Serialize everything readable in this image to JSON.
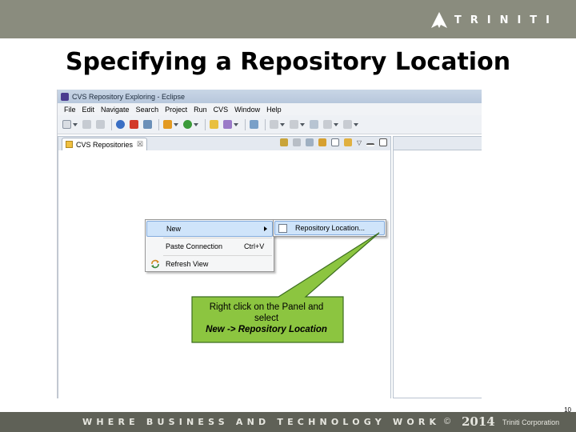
{
  "brand": {
    "name": "TRINITI",
    "logo_icon": "triniti-arrow-logo"
  },
  "slide": {
    "title": "Specifying a Repository Location",
    "page_number": "10"
  },
  "window": {
    "title": "CVS Repository Exploring - Eclipse",
    "menu": [
      "File",
      "Edit",
      "Navigate",
      "Search",
      "Project",
      "Run",
      "CVS",
      "Window",
      "Help"
    ],
    "view_tab": {
      "label": "CVS Repositories",
      "close_symbol": "☒"
    }
  },
  "context_menu": {
    "items": [
      {
        "label": "New",
        "shortcut": "",
        "has_submenu": true,
        "selected": true
      },
      {
        "label": "Paste Connection",
        "shortcut": "Ctrl+V",
        "has_submenu": false,
        "selected": false
      },
      {
        "label": "Refresh View",
        "shortcut": "",
        "has_submenu": false,
        "selected": false
      }
    ],
    "submenu": {
      "label": "Repository Location...",
      "icon": "repository-location-icon"
    }
  },
  "callout": {
    "line1": "Right click on the Panel and",
    "line2": "select",
    "line3": "New -> Repository Location",
    "fill": "#8cc540",
    "stroke": "#3c6e20"
  },
  "footer": {
    "tagline": "WHERE BUSINESS AND TECHNOLOGY WORK",
    "copyright_symbol": "©",
    "year": "2014",
    "company": "Triniti Corporation"
  },
  "colors": {
    "top_bar": "#8a8c7e",
    "footer": "#5f6157",
    "menu_highlight": "#cfe4fa"
  }
}
